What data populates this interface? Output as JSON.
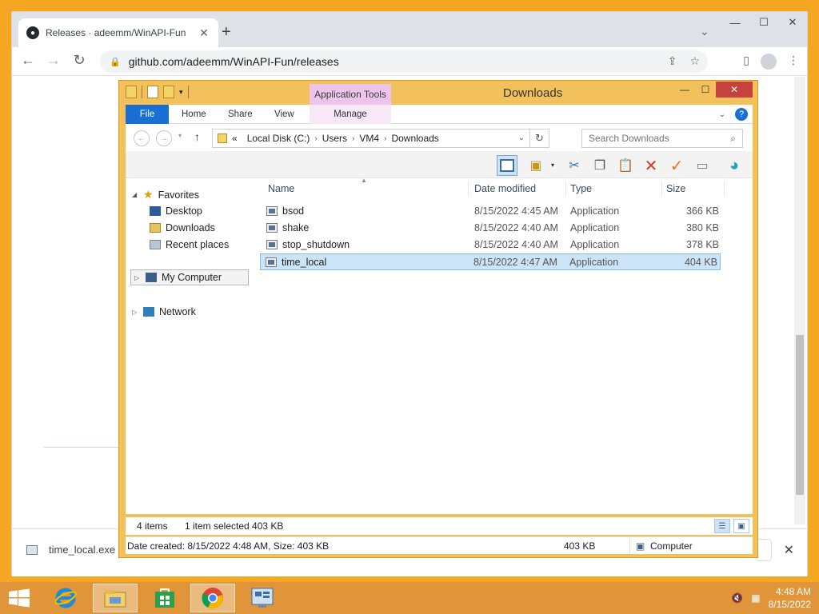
{
  "browser": {
    "tab_title": "Releases · adeemm/WinAPI-Fun",
    "tab_close": "✕",
    "new_tab": "+",
    "url": "github.com/adeemm/WinAPI-Fun/releases",
    "icons": [
      "github-icon",
      "back-icon",
      "forward-icon",
      "reload-icon",
      "lock-icon",
      "share-icon",
      "bookmark-star-icon",
      "side-panel-icon",
      "profile-icon",
      "menu-icon"
    ]
  },
  "download_bar": {
    "filename": "time_local.exe",
    "close": "✕"
  },
  "explorer": {
    "title": "Downloads",
    "contextual_tab_group": "Application Tools",
    "ribbon_tabs": [
      "File",
      "Home",
      "Share",
      "View",
      "Manage"
    ],
    "breadcrumb": {
      "prefix": "«",
      "segments": [
        "Local Disk (C:)",
        "Users",
        "VM4",
        "Downloads"
      ]
    },
    "search_placeholder": "Search Downloads",
    "nav": {
      "favorites": "Favorites",
      "desktop": "Desktop",
      "downloads": "Downloads",
      "recent": "Recent places",
      "my_computer": "My Computer",
      "network": "Network"
    },
    "columns": {
      "name": "Name",
      "date": "Date modified",
      "type": "Type",
      "size": "Size"
    },
    "files": [
      {
        "name": "bsod",
        "date": "8/15/2022 4:45 AM",
        "type": "Application",
        "size": "366 KB"
      },
      {
        "name": "shake",
        "date": "8/15/2022 4:40 AM",
        "type": "Application",
        "size": "380 KB"
      },
      {
        "name": "stop_shutdown",
        "date": "8/15/2022 4:40 AM",
        "type": "Application",
        "size": "378 KB"
      },
      {
        "name": "time_local",
        "date": "8/15/2022 4:47 AM",
        "type": "Application",
        "size": "404 KB"
      }
    ],
    "selected_index": 3,
    "status": {
      "items": "4 items",
      "selected": "1 item selected  403 KB"
    },
    "details": {
      "created": "Date created: 8/15/2022 4:48 AM, Size: 403 KB",
      "size": "403 KB",
      "location": "Computer"
    }
  },
  "taskbar": {
    "time": "4:48 AM",
    "date": "8/15/2022",
    "colors": {
      "taskbar": "#e0953a",
      "desktop": "#f5a623"
    }
  }
}
